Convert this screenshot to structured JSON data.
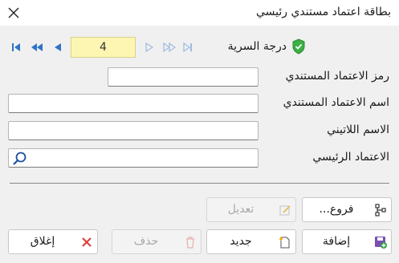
{
  "window": {
    "title": "بطاقة اعتماد مستندي رئيسي"
  },
  "icons": {
    "close": "close-icon",
    "first": "first-record-icon",
    "prev_fast": "fast-back-icon",
    "prev": "previous-icon",
    "next": "next-icon",
    "next_fast": "fast-forward-icon",
    "last": "last-record-icon",
    "secrecy": "shield-check-icon",
    "search": "search-icon",
    "branches": "tree-icon",
    "edit": "edit-icon",
    "add": "save-add-icon",
    "new": "new-document-icon",
    "delete": "trash-icon",
    "close_btn": "red-x-icon"
  },
  "navigator": {
    "record_number": "4"
  },
  "secrecy": {
    "label": "درجة السرية",
    "color": "#3cb043"
  },
  "form": {
    "credit_code": {
      "label": "رمز الاعتماد المستندي",
      "value": ""
    },
    "credit_name": {
      "label": "اسم الاعتماد المستندي",
      "value": ""
    },
    "latin_name": {
      "label": "الاسم اللاتيني",
      "value": ""
    },
    "main_credit": {
      "label": "الاعتماد الرئيسي",
      "value": ""
    }
  },
  "buttons": {
    "branches": "فروع...",
    "edit": "تعديل",
    "add": "إضافة",
    "new": "جديد",
    "delete": "حذف",
    "close": "إغلاق"
  },
  "colors": {
    "nav_blue": "#2f73c9",
    "nav_disabled": "#9dbbe0",
    "record_bg": "#fdf6b3",
    "close_red": "#d93a3a"
  }
}
